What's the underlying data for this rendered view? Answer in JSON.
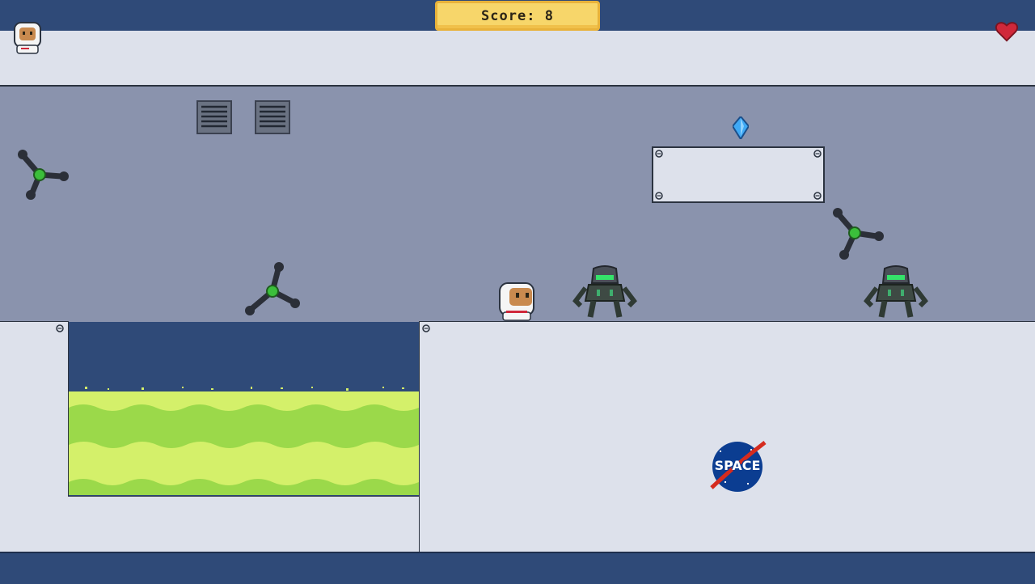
{
  "hud": {
    "score_text": "Score: 8",
    "lives_icon": "heart-icon",
    "player_icon": "astronaut-head-icon"
  },
  "level": {
    "hazard": "acid-pool",
    "emblem_text": "SPACE"
  },
  "entities": {
    "player": "astronaut",
    "enemies": [
      "spinning-drone",
      "spinning-drone",
      "spinning-drone",
      "alien-robot",
      "alien-robot"
    ],
    "collectible": "blue-crystal"
  },
  "colors": {
    "bar": "#2f4a78",
    "wall": "#dde1eb",
    "room": "#8a93ad",
    "acid_light": "#d4f06a",
    "acid_dark": "#9bd94a",
    "score_bg": "#f7d66a",
    "heart": "#d0283a"
  }
}
